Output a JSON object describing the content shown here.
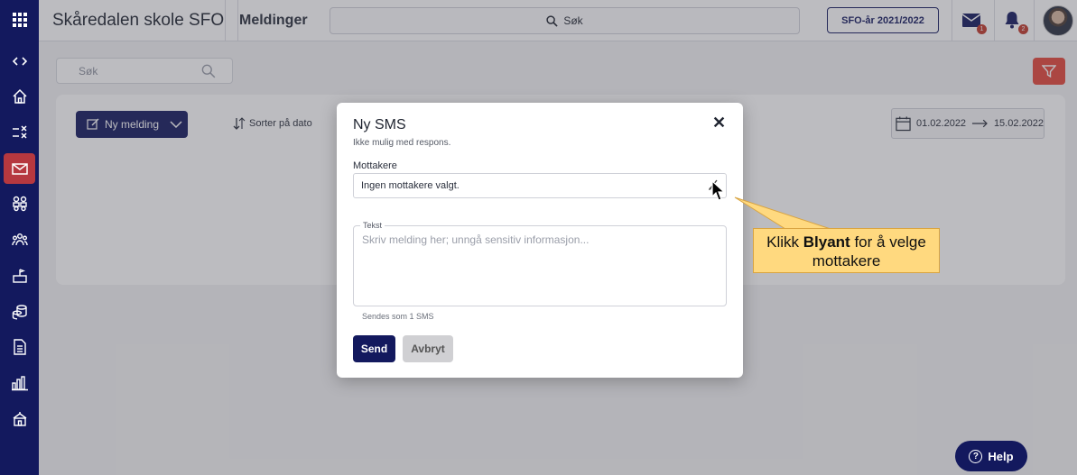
{
  "header": {
    "school_name": "Skåredalen skole SFO",
    "section": "Meldinger",
    "search_label": "Søk",
    "year_button": "SFO-år 2021/2022",
    "mail_badge": "1",
    "bell_badge": "2"
  },
  "sidebar": {
    "items": [
      "grid-icon",
      "code-icon",
      "home-icon",
      "tasks-icon",
      "mail-icon",
      "groups-icon",
      "people-icon",
      "building-icon",
      "coins-icon",
      "document-icon",
      "chart-icon",
      "school-icon"
    ]
  },
  "page": {
    "search_placeholder": "Søk",
    "new_message_label": "Ny melding",
    "sort_label": "Sorter på dato",
    "date_from": "01.02.2022",
    "date_to": "15.02.2022"
  },
  "modal": {
    "title": "Ny SMS",
    "subtitle": "Ikke mulig med respons.",
    "recipients_label": "Mottakere",
    "recipients_value": "Ingen mottakere valgt.",
    "text_legend": "Tekst",
    "text_placeholder": "Skriv melding her; unngå sensitiv informasjon...",
    "sms_count": "Sendes som 1 SMS",
    "send_label": "Send",
    "cancel_label": "Avbryt",
    "close_symbol": "✕"
  },
  "callout": {
    "prefix": "Klikk ",
    "bold": "Blyant",
    "suffix": " for å velge",
    "line2": "mottakere"
  },
  "help": {
    "label": "Help",
    "icon_symbol": "?"
  },
  "colors": {
    "navy": "#13195e",
    "active_red": "#b6383f",
    "filter_red": "#e4473a",
    "callout_yellow": "#ffd97f"
  }
}
